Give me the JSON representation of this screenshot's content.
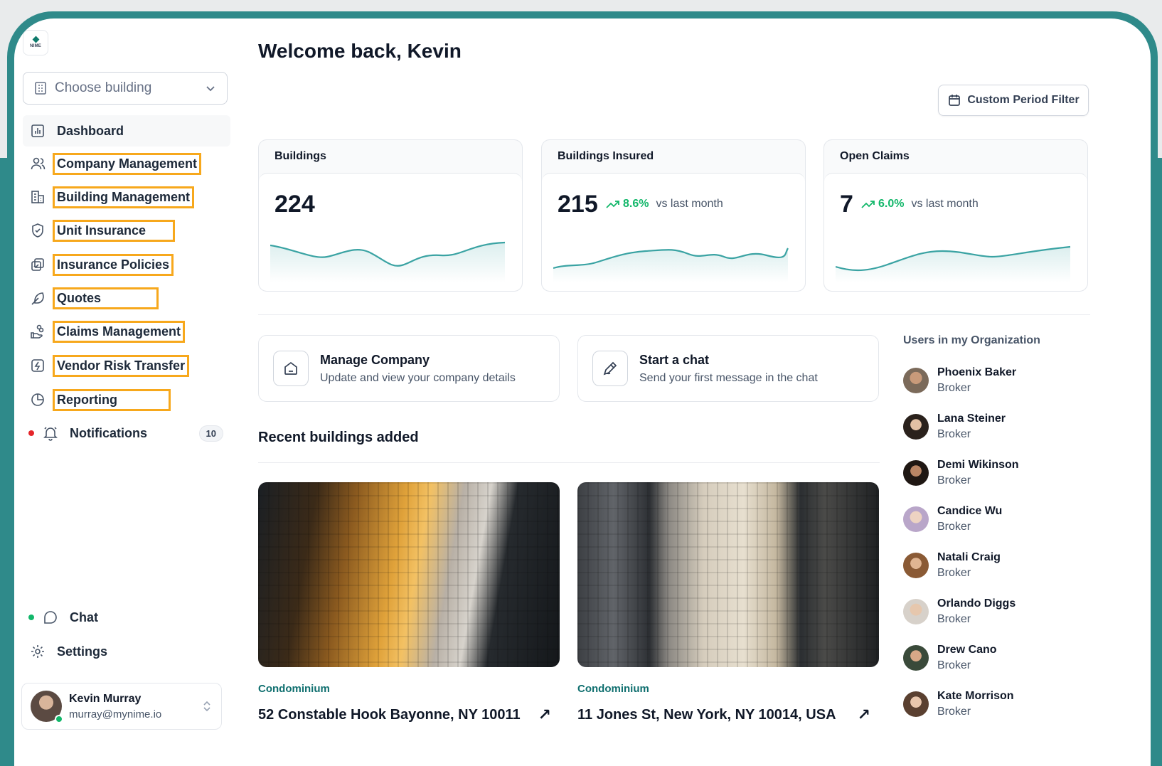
{
  "sidebar": {
    "logo_text": "NIME",
    "building_select": {
      "placeholder": "Choose building"
    },
    "items": [
      {
        "label": "Dashboard",
        "icon": "bar-chart-icon"
      },
      {
        "label": "Company Management",
        "icon": "users-icon"
      },
      {
        "label": "Building Management",
        "icon": "building-icon"
      },
      {
        "label": "Unit Insurance",
        "icon": "shield-check-icon"
      },
      {
        "label": "Insurance Policies",
        "icon": "policies-icon"
      },
      {
        "label": "Quotes",
        "icon": "feather-icon"
      },
      {
        "label": "Claims Management",
        "icon": "hand-coins-icon"
      },
      {
        "label": "Vendor Risk Transfer",
        "icon": "transfer-icon"
      },
      {
        "label": "Reporting",
        "icon": "pie-chart-icon"
      },
      {
        "label": "Notifications",
        "icon": "bell-icon",
        "badge": "10"
      }
    ],
    "bottom": [
      {
        "label": "Chat",
        "icon": "chat-icon"
      },
      {
        "label": "Settings",
        "icon": "gear-icon"
      }
    ],
    "user": {
      "name": "Kevin Murray",
      "email": "murray@mynime.io"
    }
  },
  "header": {
    "welcome": "Welcome back, Kevin",
    "filter_button": "Custom Period Filter"
  },
  "stats": [
    {
      "title": "Buildings",
      "value": "224",
      "trend": "",
      "vs": ""
    },
    {
      "title": "Buildings Insured",
      "value": "215",
      "trend": "8.6%",
      "vs": "vs last month"
    },
    {
      "title": "Open Claims",
      "value": "7",
      "trend": "6.0%",
      "vs": "vs last month"
    }
  ],
  "actions": [
    {
      "title": "Manage Company",
      "subtitle": "Update and view your company details",
      "icon": "home-icon"
    },
    {
      "title": "Start a chat",
      "subtitle": "Send your first message in the chat",
      "icon": "pen-icon"
    }
  ],
  "recent": {
    "title": "Recent buildings added",
    "buildings": [
      {
        "type": "Condominium",
        "address": "52 Constable Hook Bayonne, NY 10011"
      },
      {
        "type": "Condominium",
        "address": "11 Jones St, New York, NY 10014, USA"
      }
    ]
  },
  "org": {
    "title": "Users in my Organization",
    "users": [
      {
        "name": "Phoenix Baker",
        "role": "Broker"
      },
      {
        "name": "Lana Steiner",
        "role": "Broker"
      },
      {
        "name": "Demi Wikinson",
        "role": "Broker"
      },
      {
        "name": "Candice Wu",
        "role": "Broker"
      },
      {
        "name": "Natali Craig",
        "role": "Broker"
      },
      {
        "name": "Orlando Diggs",
        "role": "Broker"
      },
      {
        "name": "Drew Cano",
        "role": "Broker"
      },
      {
        "name": "Kate Morrison",
        "role": "Broker"
      }
    ]
  },
  "colors": {
    "accent": "#2f8a8a",
    "highlight": "#f7a81c",
    "positive": "#12b76a",
    "spark": "#3aa3a3"
  }
}
